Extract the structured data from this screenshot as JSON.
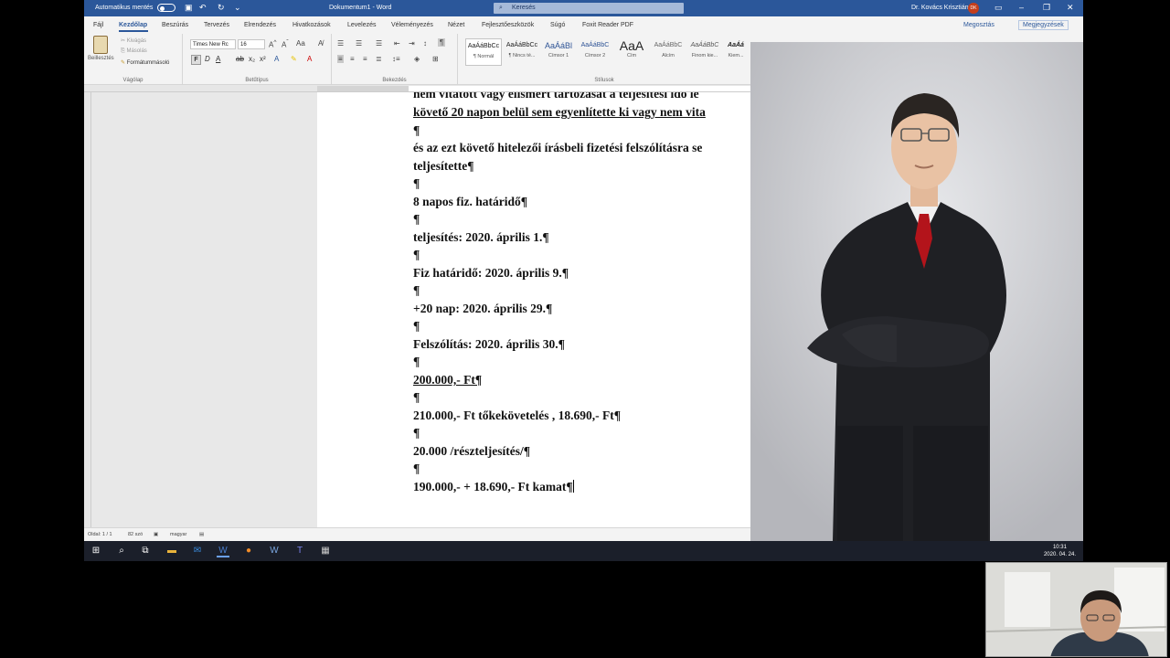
{
  "titlebar": {
    "autosave_label": "Automatikus mentés",
    "doc_title": "Dokumentum1 - Word",
    "search_placeholder": "Keresés",
    "user_name": "Dr. Kovács Krisztián",
    "user_initials": "DK"
  },
  "tabs": [
    "Fájl",
    "Kezdőlap",
    "Beszúrás",
    "Tervezés",
    "Elrendezés",
    "Hivatkozások",
    "Levelezés",
    "Véleményezés",
    "Nézet",
    "Fejlesztőeszközök",
    "Súgó",
    "Foxit Reader PDF"
  ],
  "active_tab": "Kezdőlap",
  "share_label": "Megosztás",
  "comments_label": "Megjegyzések",
  "ribbon": {
    "clipboard": {
      "paste": "Beillesztés",
      "cut": "Kivágás",
      "copy": "Másolás",
      "format_painter": "Formátummásoló",
      "group": "Vágólap"
    },
    "font": {
      "family": "Times New Rc",
      "size": "16",
      "group": "Betűtípus"
    },
    "paragraph": {
      "group": "Bekezdés"
    },
    "styles": {
      "group": "Stílusok",
      "items": [
        {
          "preview": "AaÁáBbCc",
          "name": "¶ Normál"
        },
        {
          "preview": "AaÁáBbCc",
          "name": "¶ Nincs té..."
        },
        {
          "preview": "AaÁáBl",
          "name": "Címsor 1"
        },
        {
          "preview": "AaÁáBbC",
          "name": "Címsor 2"
        },
        {
          "preview": "AaA",
          "name": "Cím"
        },
        {
          "preview": "AaÁáBbC",
          "name": "Alcím"
        },
        {
          "preview": "AaÁáBbC",
          "name": "Finom kie..."
        },
        {
          "preview": "AaÁá",
          "name": "Kiem..."
        }
      ]
    },
    "search_label": "Keresés"
  },
  "document": {
    "lines": [
      "nem vitatott vagy elismert tartozását a teljesítési idő le",
      "követő 20 napon belül sem egyenlítette ki vagy nem vita",
      "¶",
      "és az ezt követő hitelezői írásbeli fizetési felszólításra se",
      "teljesítette¶",
      "¶",
      "8 napos fiz. határidő¶",
      "¶",
      "teljesítés: 2020. április 1.¶",
      "¶",
      "Fiz határidő: 2020. április 9.¶",
      "¶",
      "+20 nap: 2020. április 29.¶",
      "¶",
      "Felszólítás: 2020. április 30.¶",
      "¶",
      "200.000,- Ft¶",
      "¶",
      "210.000,- Ft tőkekövetelés , 18.690,- Ft¶",
      "¶",
      "20.000 /részteljesítés/¶",
      "¶",
      "190.000,- + 18.690,- Ft kamat¶"
    ]
  },
  "statusbar": {
    "page": "Oldal: 1 / 1",
    "words": "82 szó",
    "language": "magyar"
  },
  "taskbar": {
    "time": "10:31",
    "date": "2020. 04. 24."
  }
}
